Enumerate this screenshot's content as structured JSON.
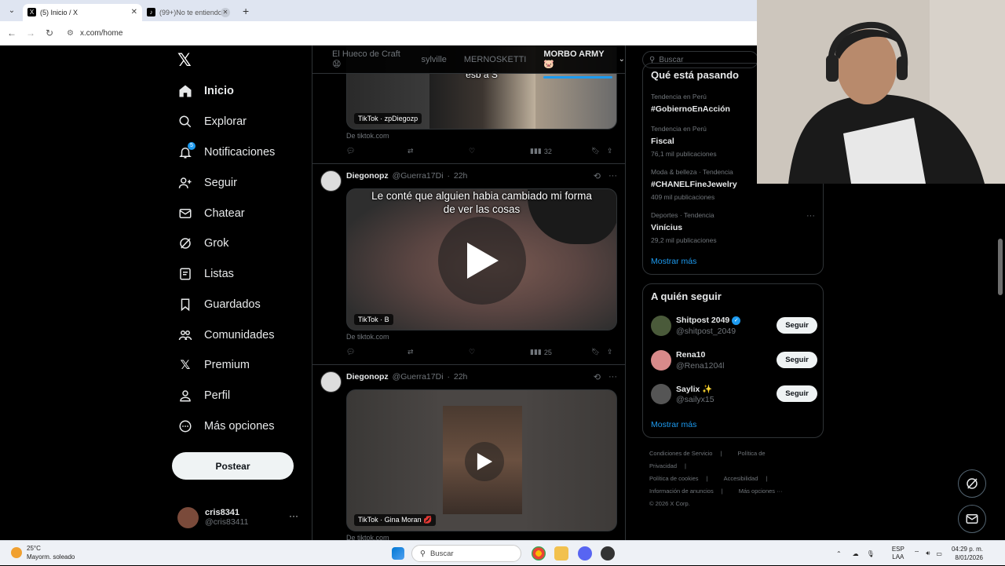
{
  "browser": {
    "tabs": [
      {
        "label": "(5) Inicio / X",
        "active": true
      },
      {
        "label": "(99+)No te entiendo",
        "active": false
      }
    ],
    "url": "x.com/home"
  },
  "sidebar": {
    "items": [
      {
        "label": "Inicio",
        "icon": "home-icon"
      },
      {
        "label": "Explorar",
        "icon": "search-icon"
      },
      {
        "label": "Notificaciones",
        "icon": "bell-icon",
        "badge": "5"
      },
      {
        "label": "Seguir",
        "icon": "add-user-icon"
      },
      {
        "label": "Chatear",
        "icon": "mail-icon"
      },
      {
        "label": "Grok",
        "icon": "grok-icon"
      },
      {
        "label": "Listas",
        "icon": "list-icon"
      },
      {
        "label": "Guardados",
        "icon": "bookmark-icon"
      },
      {
        "label": "Comunidades",
        "icon": "communities-icon"
      },
      {
        "label": "Premium",
        "icon": "x-icon"
      },
      {
        "label": "Perfil",
        "icon": "person-icon"
      },
      {
        "label": "Más opciones",
        "icon": "more-circle-icon"
      }
    ],
    "post_label": "Postear",
    "account": {
      "name": "cris8341",
      "handle": "@cris83411"
    }
  },
  "timeline": {
    "tabs": [
      "El Hueco de Craft😧",
      "sylville",
      "MERNOSKETTI",
      "MORBO ARMY 🐷"
    ],
    "posts": [
      {
        "tag": "TikTok · zpDiegozp",
        "overlay": "esb a S",
        "source": "De tiktok.com",
        "views": "32"
      },
      {
        "author": "Diegonopz",
        "handle": "@Guerra17Di",
        "time": "22h",
        "overlay": "Le conté que alguien habia cambiado mi forma de ver las cosas",
        "tag": "TikTok · B",
        "source": "De tiktok.com",
        "views": "25"
      },
      {
        "author": "Diegonopz",
        "handle": "@Guerra17Di",
        "time": "22h",
        "tag": "TikTok · Gina Moran 💋",
        "source": "De tiktok.com"
      }
    ]
  },
  "right": {
    "search_placeholder": "Buscar",
    "trends_title": "Qué está pasando",
    "trends": [
      {
        "meta": "Tendencia en Perú",
        "name": "#GobiernoEnAcción",
        "count": ""
      },
      {
        "meta": "Tendencia en Perú",
        "name": "Fiscal",
        "count": "76,1 mil publicaciones"
      },
      {
        "meta": "Moda & belleza · Tendencia",
        "name": "#CHANELFineJewelry",
        "count": "409 mil publicaciones"
      },
      {
        "meta": "Deportes · Tendencia",
        "name": "Vinícius",
        "count": "29,2 mil publicaciones"
      }
    ],
    "show_more": "Mostrar más",
    "follow_title": "A quién seguir",
    "follow": [
      {
        "name": "Shitpost 2049",
        "handle": "@shitpost_2049",
        "verified": true,
        "button": "Seguir"
      },
      {
        "name": "Rena10",
        "handle": "@Rena1204l",
        "verified": false,
        "button": "Seguir"
      },
      {
        "name": "Saylix ✨",
        "handle": "@sailyx15",
        "verified": false,
        "button": "Seguir"
      }
    ],
    "footer": [
      "Condiciones de Servicio",
      "|",
      "Política de Privacidad",
      "|",
      "Política de cookies",
      "|",
      "Accesibilidad",
      "|",
      "Información de anuncios",
      "|",
      "Más opciones ···",
      "© 2026 X Corp."
    ]
  },
  "taskbar": {
    "temp": "25°C",
    "weather": "Mayorm. soleado",
    "search": "Buscar",
    "lang1": "ESP",
    "lang2": "LAA",
    "time": "04:29 p. m.",
    "date": "8/01/2026"
  }
}
